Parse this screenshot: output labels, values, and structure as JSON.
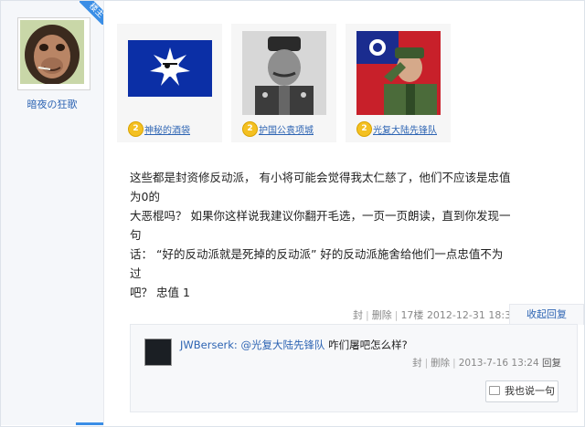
{
  "author": {
    "badge": "楼主",
    "username": "暗夜の狂歌"
  },
  "signature_cards": [
    {
      "level": "2",
      "name": "神秘的酒袋",
      "icon": "kmt-flag-pirate-image"
    },
    {
      "level": "2",
      "name": "护国公袁项城",
      "icon": "yuan-shikai-portrait-image"
    },
    {
      "level": "2",
      "name": "光复大陆先锋队",
      "icon": "soldier-salute-flag-image"
    }
  ],
  "post": {
    "lines": [
      "这些都是封资修反动派， 有小将可能会觉得我太仁慈了，他们不应该是忠值为0的",
      "大恶棍吗？ 如果你这样说我建议你翻开毛选，一页一页朗读，直到你发现一句",
      "话：  “好的反动派就是死掉的反动派”  好的反动派施舍给他们一点忠值不为过",
      "吧？ 忠值 1"
    ],
    "meta": {
      "seal": "封",
      "delete": "删除",
      "floor": "17楼",
      "time": "2012-12-31 18:34"
    },
    "retract_reply": "收起回复"
  },
  "reply": {
    "user": "JWBerserk:",
    "mention": "@光复大陆先锋队",
    "text": "咋们屠吧怎么样?",
    "meta": {
      "seal": "封",
      "delete": "删除",
      "time": "2013-7-16 13:24",
      "reply": "回复"
    },
    "say_button": "我也说一句"
  },
  "colors": {
    "link": "#2d64b3",
    "badge": "#3a8ee6",
    "level": "#f4c021"
  }
}
